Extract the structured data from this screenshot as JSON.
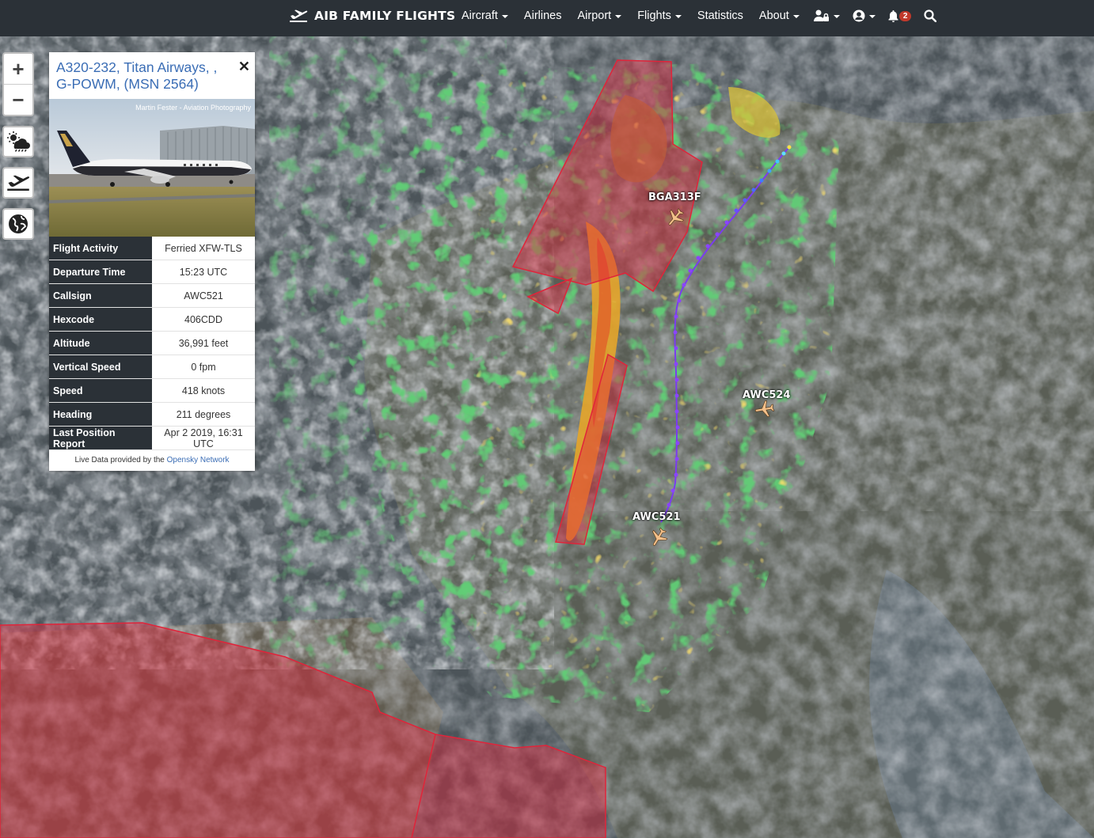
{
  "navbar": {
    "brand": "AIB FAMILY FLIGHTS",
    "items": [
      {
        "label": "Aircraft",
        "dropdown": true
      },
      {
        "label": "Airlines",
        "dropdown": false
      },
      {
        "label": "Airport",
        "dropdown": true
      },
      {
        "label": "Flights",
        "dropdown": true
      },
      {
        "label": "Statistics",
        "dropdown": false
      },
      {
        "label": "About",
        "dropdown": true
      }
    ],
    "notification_count": "2"
  },
  "map": {
    "zoom_in": "+",
    "zoom_out": "−",
    "aircraft": [
      {
        "callsign": "BGA313F"
      },
      {
        "callsign": "AWC524"
      },
      {
        "callsign": "AWC521"
      }
    ]
  },
  "panel": {
    "title": "A320-232, Titan Airways, , G-POWM, (MSN 2564)",
    "photo_credit": "Martin Fester - Aviation Photography",
    "rows": [
      {
        "label": "Flight Activity",
        "value": "Ferried XFW-TLS"
      },
      {
        "label": "Departure Time",
        "value": "15:23 UTC"
      },
      {
        "label": "Callsign",
        "value": "AWC521"
      },
      {
        "label": "Hexcode",
        "value": "406CDD"
      },
      {
        "label": "Altitude",
        "value": "36,991 feet"
      },
      {
        "label": "Vertical Speed",
        "value": "0 fpm"
      },
      {
        "label": "Speed",
        "value": "418 knots"
      },
      {
        "label": "Heading",
        "value": "211 degrees"
      },
      {
        "label": "Last Position Report",
        "value": "Apr 2 2019, 16:31 UTC"
      }
    ],
    "footer_text": "Live Data provided by the",
    "footer_link": "Opensky Network"
  },
  "colors": {
    "navbar": "#2b3137",
    "link": "#3a6db5",
    "sigmet": "#e0243a",
    "track": "#7a3cf0"
  }
}
